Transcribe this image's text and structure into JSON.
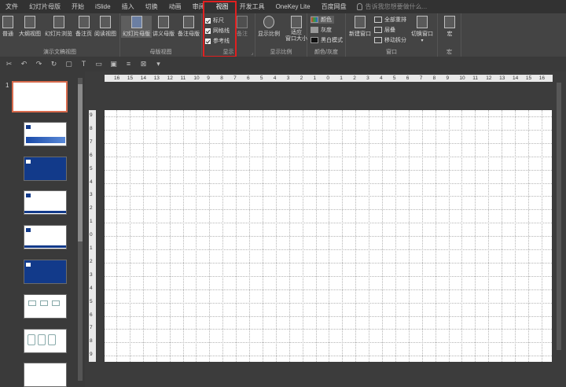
{
  "menu": {
    "tabs": [
      "文件",
      "幻灯片母版",
      "开始",
      "iSlide",
      "插入",
      "切换",
      "动画",
      "审阅",
      "视图",
      "开发工具",
      "OneKey Lite",
      "百度网盘"
    ],
    "active_tab": "视图",
    "tellme": "告诉我您想要做什么..."
  },
  "ribbon": {
    "presentation_views": {
      "label": "演示文稿视图",
      "buttons": [
        "普通",
        "大纲视图",
        "幻灯片浏览",
        "备注页",
        "阅读视图"
      ]
    },
    "master_views": {
      "label": "母版视图",
      "buttons": [
        "幻灯片母版",
        "讲义母版",
        "备注母版"
      ]
    },
    "show": {
      "label": "显示",
      "notes": "备注",
      "checkboxes": [
        "标尺",
        "网格线",
        "参考线"
      ]
    },
    "zoom": {
      "label": "显示比例",
      "zoom_button": "显示比例",
      "fit_button_line1": "适应",
      "fit_button_line2": "窗口大小"
    },
    "color": {
      "label": "颜色/灰度",
      "options": [
        "颜色",
        "灰度",
        "黑白模式"
      ]
    },
    "window": {
      "label": "窗口",
      "new_window": "新建窗口",
      "arrange_all": "全部重排",
      "cascade": "层叠",
      "move_split": "移动拆分",
      "switch_window": "切换窗口"
    },
    "macros": {
      "label": "宏",
      "button": "宏"
    }
  },
  "slides_panel": {
    "first_slide_number": "1",
    "thumbnails": [
      "blank",
      "white-banner",
      "blue",
      "white-banner",
      "white-banner",
      "blue",
      "diagram",
      "diagram",
      "white"
    ]
  },
  "ruler": {
    "horizontal": [
      "16",
      "15",
      "14",
      "13",
      "12",
      "11",
      "10",
      "9",
      "8",
      "7",
      "6",
      "5",
      "4",
      "3",
      "2",
      "1",
      "0",
      "1",
      "2",
      "3",
      "4",
      "5",
      "6",
      "7",
      "8",
      "9",
      "10",
      "11",
      "12",
      "13",
      "14",
      "15",
      "16"
    ],
    "vertical": [
      "9",
      "8",
      "7",
      "6",
      "5",
      "4",
      "3",
      "2",
      "1",
      "0",
      "1",
      "2",
      "3",
      "4",
      "5",
      "6",
      "7",
      "8",
      "9"
    ]
  },
  "colors": {
    "highlight": "#e02020",
    "accent_selected": "#6b7fa3",
    "thumb_blue": "#123a8a"
  }
}
